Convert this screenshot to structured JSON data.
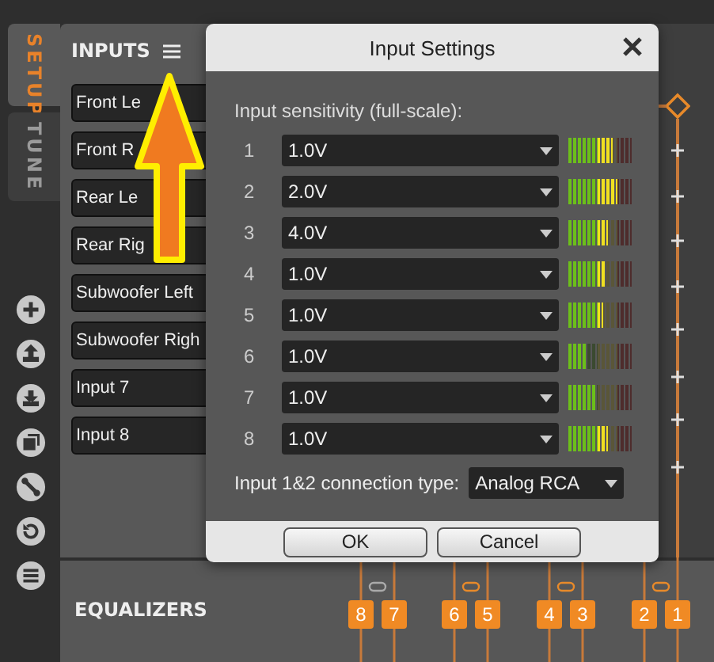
{
  "sidebar": {
    "tabs": [
      {
        "label": "SETUP",
        "selected": true
      },
      {
        "label": "TUNE",
        "selected": false
      }
    ]
  },
  "inputs_panel": {
    "title": "INPUTS",
    "channels": [
      "Front Le",
      "Front R",
      "Rear Le",
      "Rear Rig",
      "Subwoofer Left",
      "Subwoofer Righ",
      "Input 7",
      "Input 8"
    ]
  },
  "dialog": {
    "title": "Input Settings",
    "sensitivity_label": "Input sensitivity (full-scale):",
    "rows": [
      {
        "number": "1",
        "value": "1.0V",
        "level": 0.69
      },
      {
        "number": "2",
        "value": "2.0V",
        "level": 0.77
      },
      {
        "number": "3",
        "value": "4.0V",
        "level": 0.62
      },
      {
        "number": "4",
        "value": "1.0V",
        "level": 0.58
      },
      {
        "number": "5",
        "value": "1.0V",
        "level": 0.54
      },
      {
        "number": "6",
        "value": "1.0V",
        "level": 0.31
      },
      {
        "number": "7",
        "value": "1.0V",
        "level": 0.46
      },
      {
        "number": "8",
        "value": "1.0V",
        "level": 0.62
      }
    ],
    "connection": {
      "label": "Input 1&2 connection type:",
      "value": "Analog RCA"
    },
    "buttons": [
      "OK",
      "Cancel"
    ]
  },
  "equalizers": {
    "title": "EQUALIZERS",
    "channels": [
      "8",
      "7",
      "6",
      "5",
      "4",
      "3",
      "2",
      "1"
    ]
  }
}
